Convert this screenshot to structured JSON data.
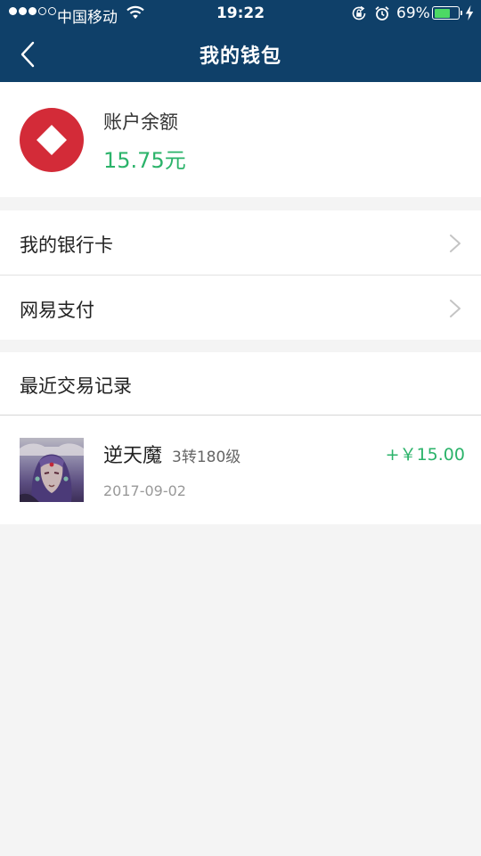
{
  "status_bar": {
    "carrier": "中国移动",
    "time": "19:22",
    "battery_percent": "69%",
    "battery_level": 0.69,
    "signal_strength": 3,
    "signal_max": 5
  },
  "nav": {
    "title": "我的钱包",
    "back_icon": "chevron-left-icon",
    "background_color": "#0f4069"
  },
  "balance": {
    "label": "账户余额",
    "value": "15.75元",
    "logo_icon": "wallet-logo",
    "logo_color": "#d32b38",
    "value_color": "#2bb36a"
  },
  "menu": {
    "items": [
      {
        "label": "我的银行卡",
        "icon": "chevron-right-icon"
      },
      {
        "label": "网易支付",
        "icon": "chevron-right-icon"
      }
    ]
  },
  "recent_transactions": {
    "title": "最近交易记录",
    "items": [
      {
        "name": "逆天魔",
        "level": "3转180级",
        "date": "2017-09-02",
        "amount": "+￥15.00",
        "avatar": "character-avatar"
      }
    ]
  }
}
